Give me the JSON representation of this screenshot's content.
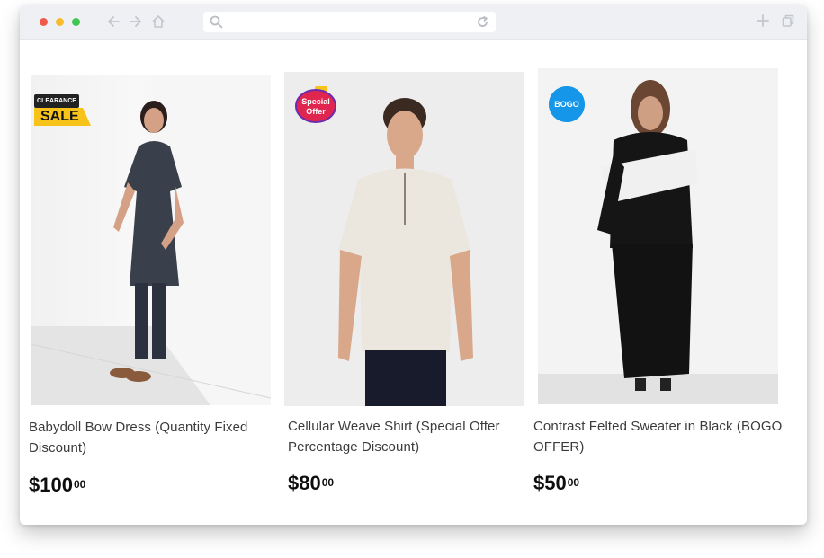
{
  "browser": {
    "url": ""
  },
  "products": [
    {
      "title": "Babydoll Bow Dress (Quantity Fixed Discount)",
      "price_main": "$100",
      "price_cents": "00",
      "badge_top": "CLEARANCE",
      "badge_bottom": "SALE"
    },
    {
      "title": "Cellular Weave Shirt (Special Offer Percentage Discount)",
      "price_main": "$80",
      "price_cents": "00",
      "badge_line1": "Special",
      "badge_line2": "Offer"
    },
    {
      "title": "Contrast Felted Sweater in Black (BOGO OFFER)",
      "price_main": "$50",
      "price_cents": "00",
      "badge": "BOGO"
    }
  ],
  "colors": {
    "dot_red": "#f0584b",
    "dot_yellow": "#f7bb2b",
    "dot_green": "#3fc650",
    "sale_yellow": "#f7c21a",
    "bogo_blue": "#1596e8",
    "special_red": "#e0264f"
  }
}
